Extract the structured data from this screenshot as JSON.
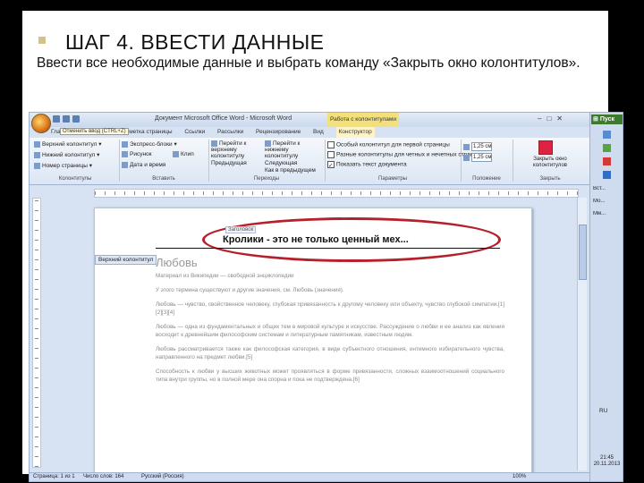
{
  "slide": {
    "title": "ШАГ 4. ВВЕСТИ ДАННЫЕ",
    "description": "Ввести все необходимые данные и выбрать команду «Закрыть окно колонтитулов»."
  },
  "word": {
    "window_title": "Документ Microsoft Office Word - Microsoft Word",
    "context_tab": "Работа с колонтитулами",
    "tooltip": "Отменить ввод (CTRL+Z)",
    "tabs": [
      "Главная",
      "Вставка",
      "Разметка страницы",
      "Ссылки",
      "Рассылки",
      "Рецензирование",
      "Вид",
      "Конструктор"
    ],
    "ribbon": {
      "header_btn": "Верхний колонтитул",
      "footer_btn": "Нижний колонтитул",
      "pagenum_btn": "Номер страницы",
      "group_headers": "Колонтитулы",
      "express": "Экспресс-блоки",
      "picture": "Рисунок",
      "date": "Дата и время",
      "clip": "Клип",
      "group_insert": "Вставить",
      "go_header": "Перейти к верхнему колонтитулу",
      "go_footer": "Перейти к нижнему колонтитулу",
      "prev": "Предыдущая",
      "next": "Следующая",
      "link": "Как в предыдущем",
      "group_nav": "Переходы",
      "opt1": "Особый колонтитул для первой страницы",
      "opt2": "Разные колонтитулы для четных и нечетных страниц",
      "opt3": "Показать текст документа",
      "group_params": "Параметры",
      "pos1": "1,25 см",
      "pos2": "1,25 см",
      "group_pos": "Положение",
      "close": "Закрыть окно колонтитулов",
      "group_close": "Закрыть"
    },
    "document": {
      "header_tag": "Заголовок",
      "header_text": "Кролики - это не только ценный мех...",
      "header_label": "Верхний колонтитул",
      "heading": "Любовь",
      "p1": "Материал из Википедии — свободной энциклопедии",
      "p2": "У этого термина существуют и другие значения, см. Любовь (значения).",
      "p3": "Любовь — чувство, свойственное человеку, глубокая привязанность к другому человеку или объекту, чувство глубокой симпатии.[1][2][3][4]",
      "p4": "Любовь — одна из фундаментальных и общих тем в мировой культуре и искусстве. Рассуждение о любви и ее анализ как явления восходит к древнейшим философским системам и литературным памятникам, известным людям.",
      "p5": "Любовь рассматривается также как философская категория, в виде субъектного отношения, интимного избирательного чувства, направленного на предмет любви.[5]",
      "p6": "Способность к любви у высших животных может проявляться в форме привязанности, сложных взаимоотношений социального типа внутри группы, но в полной мере она спорна и пока не подтверждена.[6]"
    },
    "status": {
      "page": "Страница: 1 из 1",
      "words": "Число слов: 164",
      "lang": "Русский (Россия)",
      "zoom": "100%"
    },
    "taskbar": {
      "start": "Пуск",
      "items": [
        "Вст...",
        "Мо...",
        "Мм..."
      ],
      "lang": "RU",
      "time": "21:45",
      "date": "20.11.2013"
    }
  }
}
